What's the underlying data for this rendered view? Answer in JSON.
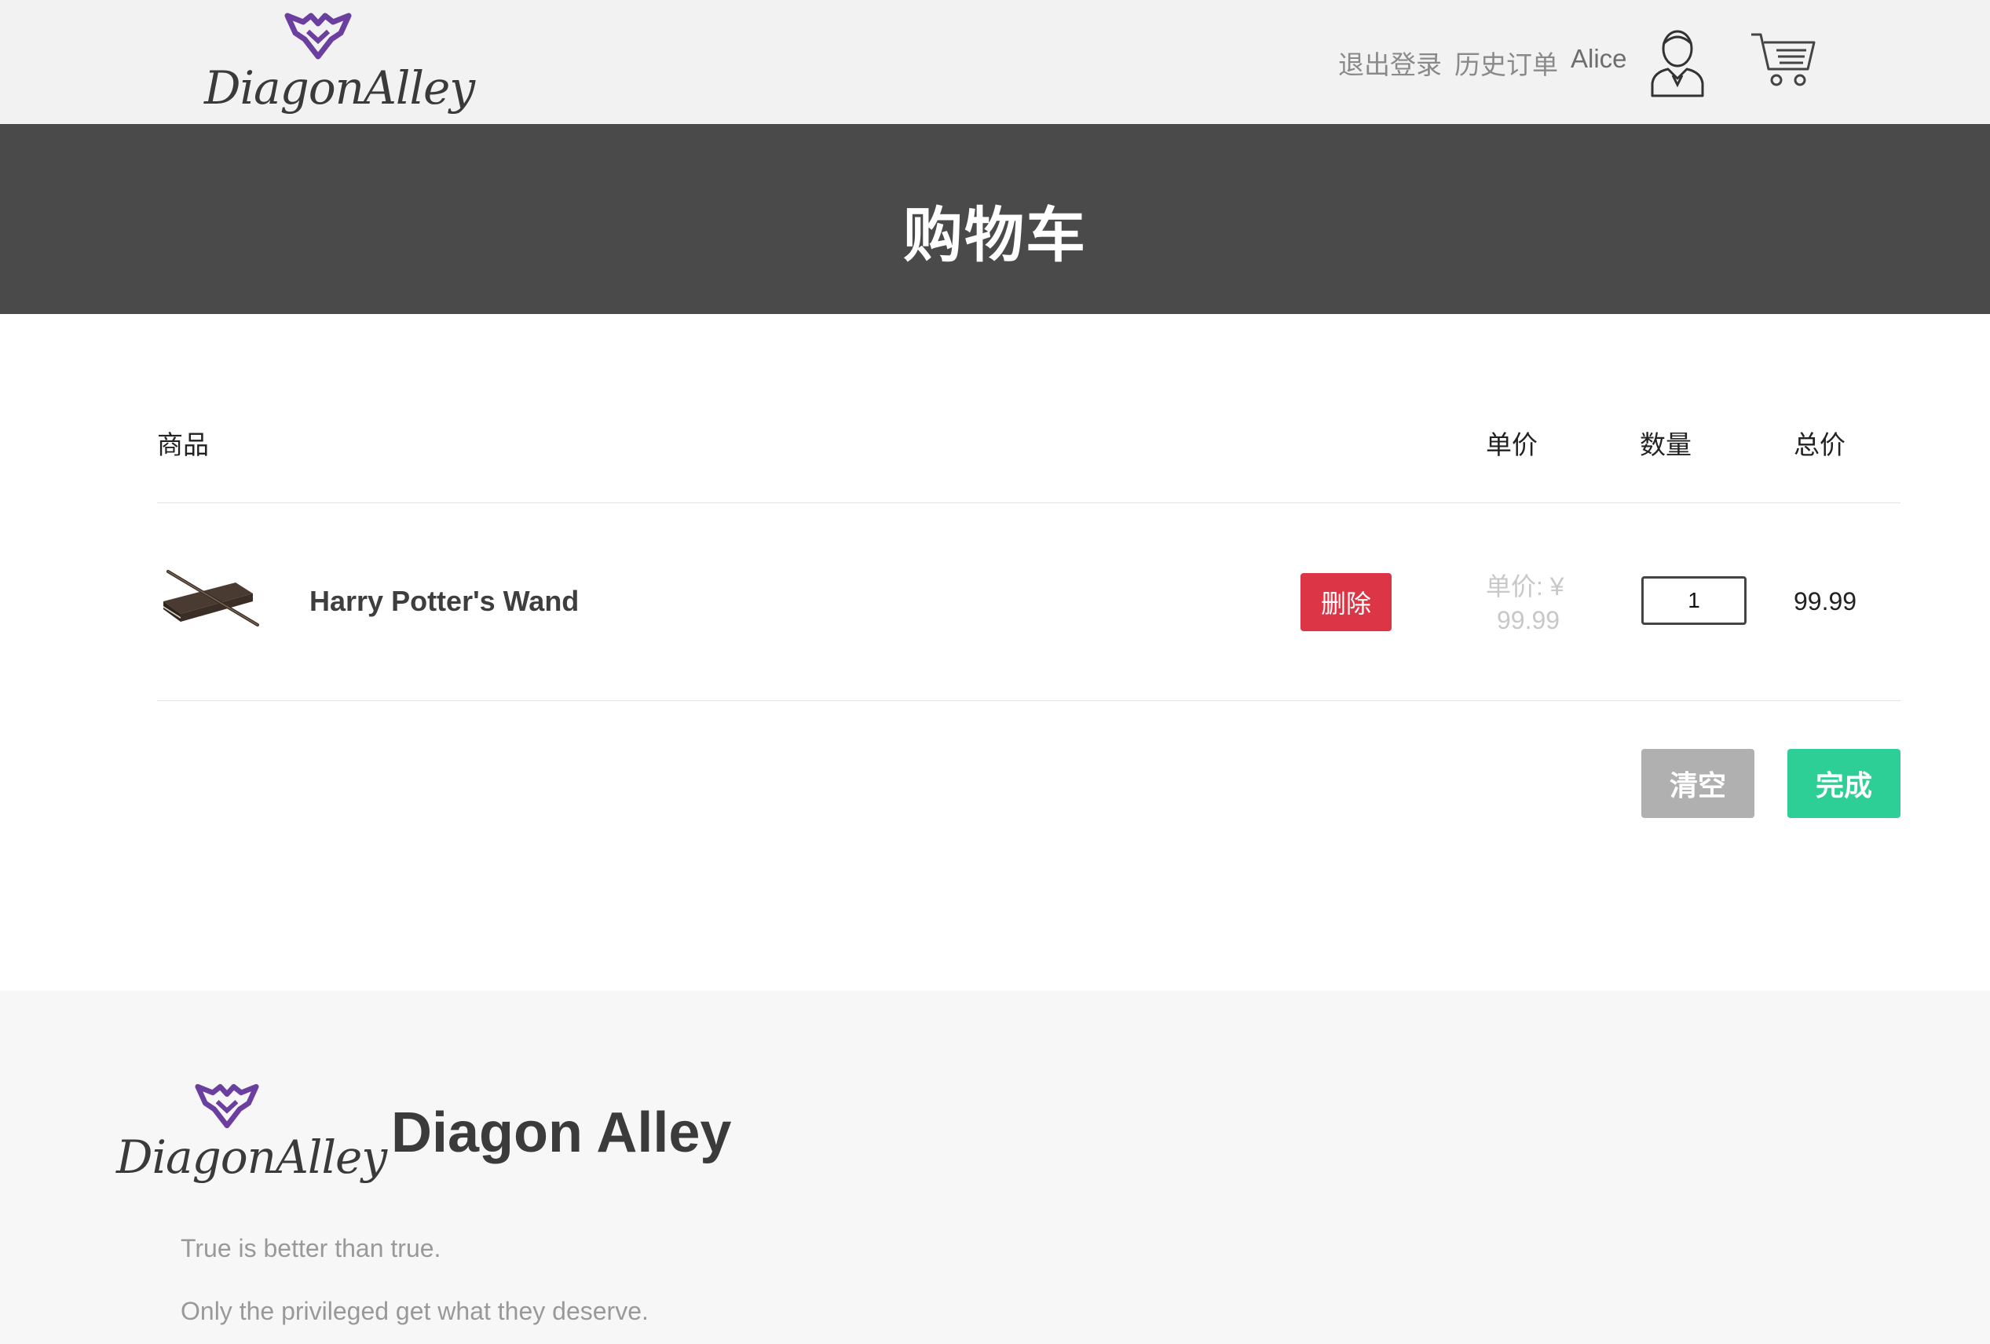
{
  "header": {
    "logo_text": "DiagonAlley",
    "logout_label": "退出登录",
    "history_label": "历史订单",
    "username": "Alice",
    "icons": [
      "user-icon",
      "shopping-cart-icon"
    ]
  },
  "banner": {
    "title": "购物车"
  },
  "table": {
    "columns": [
      "商品",
      "单价",
      "数量",
      "总价"
    ],
    "items": [
      {
        "name": "Harry Potter's Wand",
        "delete_label": "删除",
        "unit_price_label": "单价: ¥",
        "unit_price": "99.99",
        "quantity": "1",
        "total": "99.99"
      }
    ]
  },
  "actions": {
    "clear_label": "清空",
    "done_label": "完成"
  },
  "footer": {
    "logo_text": "DiagonAlley",
    "brand": "Diagon Alley",
    "lines": [
      "True is better than true.",
      "Only the privileged get what they deserve."
    ]
  },
  "colors": {
    "accent_purple": "#6b3fa0",
    "delete_red": "#dc3545",
    "done_green": "#2dcf96",
    "clear_gray": "#b0b0b0",
    "banner_dark": "#4a4a4a"
  }
}
